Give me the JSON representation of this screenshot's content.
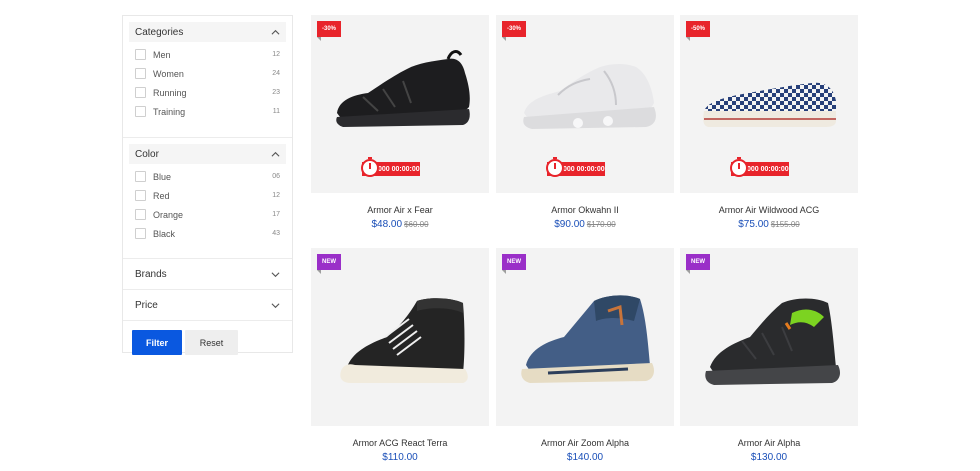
{
  "filters": {
    "categories": {
      "title": "Categories",
      "options": [
        {
          "label": "Men",
          "count": "12"
        },
        {
          "label": "Women",
          "count": "24"
        },
        {
          "label": "Running",
          "count": "23"
        },
        {
          "label": "Training",
          "count": "11"
        }
      ]
    },
    "color": {
      "title": "Color",
      "options": [
        {
          "label": "Blue",
          "count": "06"
        },
        {
          "label": "Red",
          "count": "12"
        },
        {
          "label": "Orange",
          "count": "17"
        },
        {
          "label": "Black",
          "count": "43"
        }
      ]
    },
    "brands": {
      "title": "Brands"
    },
    "price": {
      "title": "Price"
    },
    "filter_label": "Filter",
    "reset_label": "Reset"
  },
  "colors": {
    "accent": "#0a58e0",
    "sale": "#e8242b",
    "new": "#9a2fc8",
    "price": "#1a4fb8"
  },
  "products": [
    {
      "name": "Armor Air x Fear",
      "price": "$48.00",
      "old_price": "$60.00",
      "badge": "-30%",
      "timer": "000 00:00:00"
    },
    {
      "name": "Armor Okwahn II",
      "price": "$90.00",
      "old_price": "$170.00",
      "badge": "-30%",
      "timer": "000 00:00:00"
    },
    {
      "name": "Armor Air Wildwood ACG",
      "price": "$75.00",
      "old_price": "$155.00",
      "badge": "-50%",
      "timer": "000 00:00:00"
    },
    {
      "name": "Armor ACG React Terra",
      "price": "$110.00",
      "badge": "NEW"
    },
    {
      "name": "Armor Air Zoom Alpha",
      "price": "$140.00",
      "badge": "NEW"
    },
    {
      "name": "Armor Air Alpha",
      "price": "$130.00",
      "badge": "NEW"
    }
  ]
}
